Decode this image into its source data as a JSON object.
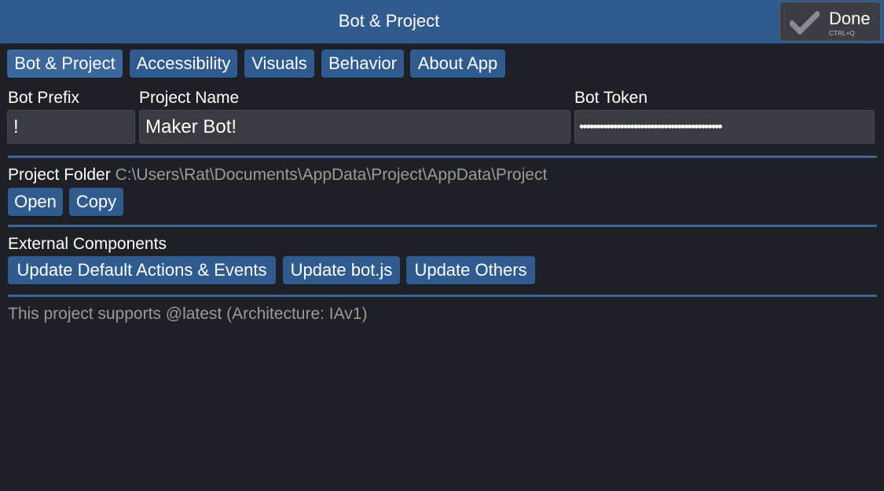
{
  "header": {
    "title": "Bot & Project",
    "done_label": "Done",
    "done_shortcut": "CTRL+Q"
  },
  "tabs": [
    {
      "label": "Bot & Project"
    },
    {
      "label": "Accessibility"
    },
    {
      "label": "Visuals"
    },
    {
      "label": "Behavior"
    },
    {
      "label": "About App"
    }
  ],
  "fields": {
    "prefix": {
      "label": "Bot Prefix",
      "value": "!"
    },
    "project_name": {
      "label": "Project Name",
      "value": "Maker Bot!"
    },
    "token": {
      "label": "Bot Token",
      "value": "••••••••••••••••••••••••••••••••••••••••••"
    }
  },
  "project_folder": {
    "label": "Project Folder",
    "path": "C:\\Users\\Rat\\Documents\\AppData\\Project\\AppData\\Project",
    "open_label": "Open",
    "copy_label": "Copy"
  },
  "external": {
    "heading": "External Components",
    "update_actions_label": "Update Default Actions & Events",
    "update_botjs_label": "Update bot.js",
    "update_others_label": "Update Others"
  },
  "footer": {
    "support_text": "This project supports @latest (Architecture: IAv1)"
  }
}
